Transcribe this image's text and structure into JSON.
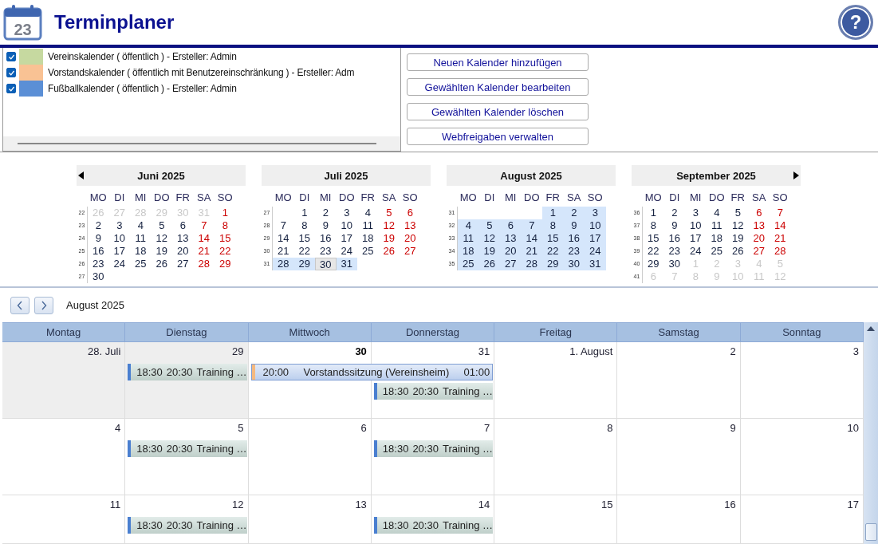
{
  "header": {
    "icon_day": "23",
    "title": "Terminplaner",
    "help_label": "?"
  },
  "calendars": [
    {
      "name": "Vereinskalender ( öffentlich ) - Ersteller: Admin",
      "checked": true,
      "color": "#c6d9a0"
    },
    {
      "name": "Vorstandskalender ( öffentlich mit Benutzereinschränkung ) - Ersteller: Adm",
      "checked": true,
      "color": "#f9c294"
    },
    {
      "name": "Fußballkalender ( öffentlich ) - Ersteller: Admin",
      "checked": true,
      "color": "#5b8fd6"
    }
  ],
  "calendar_buttons": [
    "Neuen Kalender hinzufügen",
    "Gewählten Kalender bearbeiten",
    "Gewählten Kalender löschen",
    "Webfreigaben verwalten"
  ],
  "mini_months": [
    {
      "title": "Juni 2025",
      "has_prev": true,
      "has_next": false,
      "weekdays": [
        "MO",
        "DI",
        "MI",
        "DO",
        "FR",
        "SA",
        "SO"
      ],
      "weeks": [
        {
          "number": "22",
          "days": [
            {
              "d": "26",
              "kind": "muted",
              "selected": false,
              "today": false
            },
            {
              "d": "27",
              "kind": "muted",
              "selected": false,
              "today": false
            },
            {
              "d": "28",
              "kind": "muted",
              "selected": false,
              "today": false
            },
            {
              "d": "29",
              "kind": "muted",
              "selected": false,
              "today": false
            },
            {
              "d": "30",
              "kind": "muted",
              "selected": false,
              "today": false
            },
            {
              "d": "31",
              "kind": "muted",
              "selected": false,
              "today": false
            },
            {
              "d": "1",
              "kind": "weekend",
              "selected": false,
              "today": false
            }
          ]
        },
        {
          "number": "23",
          "days": [
            {
              "d": "2",
              "kind": "normal",
              "selected": false,
              "today": false
            },
            {
              "d": "3",
              "kind": "normal",
              "selected": false,
              "today": false
            },
            {
              "d": "4",
              "kind": "normal",
              "selected": false,
              "today": false
            },
            {
              "d": "5",
              "kind": "normal",
              "selected": false,
              "today": false
            },
            {
              "d": "6",
              "kind": "normal",
              "selected": false,
              "today": false
            },
            {
              "d": "7",
              "kind": "weekend",
              "selected": false,
              "today": false
            },
            {
              "d": "8",
              "kind": "weekend",
              "selected": false,
              "today": false
            }
          ]
        },
        {
          "number": "24",
          "days": [
            {
              "d": "9",
              "kind": "normal",
              "selected": false,
              "today": false
            },
            {
              "d": "10",
              "kind": "normal",
              "selected": false,
              "today": false
            },
            {
              "d": "11",
              "kind": "normal",
              "selected": false,
              "today": false
            },
            {
              "d": "12",
              "kind": "normal",
              "selected": false,
              "today": false
            },
            {
              "d": "13",
              "kind": "normal",
              "selected": false,
              "today": false
            },
            {
              "d": "14",
              "kind": "weekend",
              "selected": false,
              "today": false
            },
            {
              "d": "15",
              "kind": "weekend",
              "selected": false,
              "today": false
            }
          ]
        },
        {
          "number": "25",
          "days": [
            {
              "d": "16",
              "kind": "normal",
              "selected": false,
              "today": false
            },
            {
              "d": "17",
              "kind": "normal",
              "selected": false,
              "today": false
            },
            {
              "d": "18",
              "kind": "normal",
              "selected": false,
              "today": false
            },
            {
              "d": "19",
              "kind": "normal",
              "selected": false,
              "today": false
            },
            {
              "d": "20",
              "kind": "normal",
              "selected": false,
              "today": false
            },
            {
              "d": "21",
              "kind": "weekend",
              "selected": false,
              "today": false
            },
            {
              "d": "22",
              "kind": "weekend",
              "selected": false,
              "today": false
            }
          ]
        },
        {
          "number": "26",
          "days": [
            {
              "d": "23",
              "kind": "normal",
              "selected": false,
              "today": false
            },
            {
              "d": "24",
              "kind": "normal",
              "selected": false,
              "today": false
            },
            {
              "d": "25",
              "kind": "normal",
              "selected": false,
              "today": false
            },
            {
              "d": "26",
              "kind": "normal",
              "selected": false,
              "today": false
            },
            {
              "d": "27",
              "kind": "normal",
              "selected": false,
              "today": false
            },
            {
              "d": "28",
              "kind": "weekend",
              "selected": false,
              "today": false
            },
            {
              "d": "29",
              "kind": "weekend",
              "selected": false,
              "today": false
            }
          ]
        },
        {
          "number": "27",
          "days": [
            {
              "d": "30",
              "kind": "normal",
              "selected": false,
              "today": false
            },
            {
              "kind": "blank"
            },
            {
              "kind": "blank"
            },
            {
              "kind": "blank"
            },
            {
              "kind": "blank"
            },
            {
              "kind": "blank"
            },
            {
              "kind": "blank"
            }
          ]
        }
      ]
    },
    {
      "title": "Juli 2025",
      "has_prev": false,
      "has_next": false,
      "weekdays": [
        "MO",
        "DI",
        "MI",
        "DO",
        "FR",
        "SA",
        "SO"
      ],
      "weeks": [
        {
          "number": "27",
          "days": [
            {
              "kind": "blank"
            },
            {
              "d": "1",
              "kind": "normal",
              "selected": false,
              "today": false
            },
            {
              "d": "2",
              "kind": "normal",
              "selected": false,
              "today": false
            },
            {
              "d": "3",
              "kind": "normal",
              "selected": false,
              "today": false
            },
            {
              "d": "4",
              "kind": "normal",
              "selected": false,
              "today": false
            },
            {
              "d": "5",
              "kind": "weekend",
              "selected": false,
              "today": false
            },
            {
              "d": "6",
              "kind": "weekend",
              "selected": false,
              "today": false
            }
          ]
        },
        {
          "number": "28",
          "days": [
            {
              "d": "7",
              "kind": "normal",
              "selected": false,
              "today": false
            },
            {
              "d": "8",
              "kind": "normal",
              "selected": false,
              "today": false
            },
            {
              "d": "9",
              "kind": "normal",
              "selected": false,
              "today": false
            },
            {
              "d": "10",
              "kind": "normal",
              "selected": false,
              "today": false
            },
            {
              "d": "11",
              "kind": "normal",
              "selected": false,
              "today": false
            },
            {
              "d": "12",
              "kind": "weekend",
              "selected": false,
              "today": false
            },
            {
              "d": "13",
              "kind": "weekend",
              "selected": false,
              "today": false
            }
          ]
        },
        {
          "number": "29",
          "days": [
            {
              "d": "14",
              "kind": "normal",
              "selected": false,
              "today": false
            },
            {
              "d": "15",
              "kind": "normal",
              "selected": false,
              "today": false
            },
            {
              "d": "16",
              "kind": "normal",
              "selected": false,
              "today": false
            },
            {
              "d": "17",
              "kind": "normal",
              "selected": false,
              "today": false
            },
            {
              "d": "18",
              "kind": "normal",
              "selected": false,
              "today": false
            },
            {
              "d": "19",
              "kind": "weekend",
              "selected": false,
              "today": false
            },
            {
              "d": "20",
              "kind": "weekend",
              "selected": false,
              "today": false
            }
          ]
        },
        {
          "number": "30",
          "days": [
            {
              "d": "21",
              "kind": "normal",
              "selected": false,
              "today": false
            },
            {
              "d": "22",
              "kind": "normal",
              "selected": false,
              "today": false
            },
            {
              "d": "23",
              "kind": "normal",
              "selected": false,
              "today": false
            },
            {
              "d": "24",
              "kind": "normal",
              "selected": false,
              "today": false
            },
            {
              "d": "25",
              "kind": "normal",
              "selected": false,
              "today": false
            },
            {
              "d": "26",
              "kind": "weekend",
              "selected": false,
              "today": false
            },
            {
              "d": "27",
              "kind": "weekend",
              "selected": false,
              "today": false
            }
          ]
        },
        {
          "number": "31",
          "days": [
            {
              "d": "28",
              "kind": "normal",
              "selected": true,
              "today": false
            },
            {
              "d": "29",
              "kind": "normal",
              "selected": true,
              "today": false
            },
            {
              "d": "30",
              "kind": "normal",
              "selected": true,
              "today": true
            },
            {
              "d": "31",
              "kind": "normal",
              "selected": true,
              "today": false
            },
            {
              "kind": "blank"
            },
            {
              "kind": "blank"
            },
            {
              "kind": "blank"
            }
          ]
        }
      ]
    },
    {
      "title": "August 2025",
      "has_prev": false,
      "has_next": false,
      "weekdays": [
        "MO",
        "DI",
        "MI",
        "DO",
        "FR",
        "SA",
        "SO"
      ],
      "weeks": [
        {
          "number": "31",
          "days": [
            {
              "kind": "blank"
            },
            {
              "kind": "blank"
            },
            {
              "kind": "blank"
            },
            {
              "kind": "blank"
            },
            {
              "d": "1",
              "kind": "normal",
              "selected": true,
              "today": false
            },
            {
              "d": "2",
              "kind": "normal",
              "selected": true,
              "today": false
            },
            {
              "d": "3",
              "kind": "normal",
              "selected": true,
              "today": false
            }
          ]
        },
        {
          "number": "32",
          "days": [
            {
              "d": "4",
              "kind": "normal",
              "selected": true,
              "today": false
            },
            {
              "d": "5",
              "kind": "normal",
              "selected": true,
              "today": false
            },
            {
              "d": "6",
              "kind": "normal",
              "selected": true,
              "today": false
            },
            {
              "d": "7",
              "kind": "normal",
              "selected": true,
              "today": false
            },
            {
              "d": "8",
              "kind": "normal",
              "selected": true,
              "today": false
            },
            {
              "d": "9",
              "kind": "normal",
              "selected": true,
              "today": false
            },
            {
              "d": "10",
              "kind": "normal",
              "selected": true,
              "today": false
            }
          ]
        },
        {
          "number": "33",
          "days": [
            {
              "d": "11",
              "kind": "normal",
              "selected": true,
              "today": false
            },
            {
              "d": "12",
              "kind": "normal",
              "selected": true,
              "today": false
            },
            {
              "d": "13",
              "kind": "normal",
              "selected": true,
              "today": false
            },
            {
              "d": "14",
              "kind": "normal",
              "selected": true,
              "today": false
            },
            {
              "d": "15",
              "kind": "normal",
              "selected": true,
              "today": false
            },
            {
              "d": "16",
              "kind": "normal",
              "selected": true,
              "today": false
            },
            {
              "d": "17",
              "kind": "normal",
              "selected": true,
              "today": false
            }
          ]
        },
        {
          "number": "34",
          "days": [
            {
              "d": "18",
              "kind": "normal",
              "selected": true,
              "today": false
            },
            {
              "d": "19",
              "kind": "normal",
              "selected": true,
              "today": false
            },
            {
              "d": "20",
              "kind": "normal",
              "selected": true,
              "today": false
            },
            {
              "d": "21",
              "kind": "normal",
              "selected": true,
              "today": false
            },
            {
              "d": "22",
              "kind": "normal",
              "selected": true,
              "today": false
            },
            {
              "d": "23",
              "kind": "normal",
              "selected": true,
              "today": false
            },
            {
              "d": "24",
              "kind": "normal",
              "selected": true,
              "today": false
            }
          ]
        },
        {
          "number": "35",
          "days": [
            {
              "d": "25",
              "kind": "normal",
              "selected": true,
              "today": false
            },
            {
              "d": "26",
              "kind": "normal",
              "selected": true,
              "today": false
            },
            {
              "d": "27",
              "kind": "normal",
              "selected": true,
              "today": false
            },
            {
              "d": "28",
              "kind": "normal",
              "selected": true,
              "today": false
            },
            {
              "d": "29",
              "kind": "normal",
              "selected": true,
              "today": false
            },
            {
              "d": "30",
              "kind": "normal",
              "selected": true,
              "today": false
            },
            {
              "d": "31",
              "kind": "normal",
              "selected": true,
              "today": false
            }
          ]
        }
      ]
    },
    {
      "title": "September 2025",
      "has_prev": false,
      "has_next": true,
      "weekdays": [
        "MO",
        "DI",
        "MI",
        "DO",
        "FR",
        "SA",
        "SO"
      ],
      "weeks": [
        {
          "number": "36",
          "days": [
            {
              "d": "1",
              "kind": "normal",
              "selected": false,
              "today": false
            },
            {
              "d": "2",
              "kind": "normal",
              "selected": false,
              "today": false
            },
            {
              "d": "3",
              "kind": "normal",
              "selected": false,
              "today": false
            },
            {
              "d": "4",
              "kind": "normal",
              "selected": false,
              "today": false
            },
            {
              "d": "5",
              "kind": "normal",
              "selected": false,
              "today": false
            },
            {
              "d": "6",
              "kind": "weekend",
              "selected": false,
              "today": false
            },
            {
              "d": "7",
              "kind": "weekend",
              "selected": false,
              "today": false
            }
          ]
        },
        {
          "number": "37",
          "days": [
            {
              "d": "8",
              "kind": "normal",
              "selected": false,
              "today": false
            },
            {
              "d": "9",
              "kind": "normal",
              "selected": false,
              "today": false
            },
            {
              "d": "10",
              "kind": "normal",
              "selected": false,
              "today": false
            },
            {
              "d": "11",
              "kind": "normal",
              "selected": false,
              "today": false
            },
            {
              "d": "12",
              "kind": "normal",
              "selected": false,
              "today": false
            },
            {
              "d": "13",
              "kind": "weekend",
              "selected": false,
              "today": false
            },
            {
              "d": "14",
              "kind": "weekend",
              "selected": false,
              "today": false
            }
          ]
        },
        {
          "number": "38",
          "days": [
            {
              "d": "15",
              "kind": "normal",
              "selected": false,
              "today": false
            },
            {
              "d": "16",
              "kind": "normal",
              "selected": false,
              "today": false
            },
            {
              "d": "17",
              "kind": "normal",
              "selected": false,
              "today": false
            },
            {
              "d": "18",
              "kind": "normal",
              "selected": false,
              "today": false
            },
            {
              "d": "19",
              "kind": "normal",
              "selected": false,
              "today": false
            },
            {
              "d": "20",
              "kind": "weekend",
              "selected": false,
              "today": false
            },
            {
              "d": "21",
              "kind": "weekend",
              "selected": false,
              "today": false
            }
          ]
        },
        {
          "number": "39",
          "days": [
            {
              "d": "22",
              "kind": "normal",
              "selected": false,
              "today": false
            },
            {
              "d": "23",
              "kind": "normal",
              "selected": false,
              "today": false
            },
            {
              "d": "24",
              "kind": "normal",
              "selected": false,
              "today": false
            },
            {
              "d": "25",
              "kind": "normal",
              "selected": false,
              "today": false
            },
            {
              "d": "26",
              "kind": "normal",
              "selected": false,
              "today": false
            },
            {
              "d": "27",
              "kind": "weekend",
              "selected": false,
              "today": false
            },
            {
              "d": "28",
              "kind": "weekend",
              "selected": false,
              "today": false
            }
          ]
        },
        {
          "number": "40",
          "days": [
            {
              "d": "29",
              "kind": "normal",
              "selected": false,
              "today": false
            },
            {
              "d": "30",
              "kind": "normal",
              "selected": false,
              "today": false
            },
            {
              "d": "1",
              "kind": "muted",
              "selected": false,
              "today": false
            },
            {
              "d": "2",
              "kind": "muted",
              "selected": false,
              "today": false
            },
            {
              "d": "3",
              "kind": "muted",
              "selected": false,
              "today": false
            },
            {
              "d": "4",
              "kind": "muted",
              "selected": false,
              "today": false
            },
            {
              "d": "5",
              "kind": "muted",
              "selected": false,
              "today": false
            }
          ]
        },
        {
          "number": "41",
          "days": [
            {
              "d": "6",
              "kind": "muted",
              "selected": false,
              "today": false
            },
            {
              "d": "7",
              "kind": "muted",
              "selected": false,
              "today": false
            },
            {
              "d": "8",
              "kind": "muted",
              "selected": false,
              "today": false
            },
            {
              "d": "9",
              "kind": "muted",
              "selected": false,
              "today": false
            },
            {
              "d": "10",
              "kind": "muted",
              "selected": false,
              "today": false
            },
            {
              "d": "11",
              "kind": "muted",
              "selected": false,
              "today": false
            },
            {
              "d": "12",
              "kind": "muted",
              "selected": false,
              "today": false
            }
          ]
        }
      ]
    }
  ],
  "month_view": {
    "title": "August 2025",
    "columns": [
      "Montag",
      "Dienstag",
      "Mittwoch",
      "Donnerstag",
      "Freitag",
      "Samstag",
      "Sonntag"
    ],
    "weeks": [
      {
        "cells": [
          {
            "label": "28. Juli",
            "shaded": true,
            "today": false
          },
          {
            "label": "29",
            "shaded": true,
            "today": false
          },
          {
            "label": "30",
            "shaded": false,
            "today": true
          },
          {
            "label": "31",
            "shaded": false,
            "today": false
          },
          {
            "label": "1. August",
            "shaded": false,
            "today": false
          },
          {
            "label": "2",
            "shaded": false,
            "today": false
          },
          {
            "label": "3",
            "shaded": false,
            "today": false
          }
        ],
        "lanes": [
          [
            {
              "kind": "empty"
            },
            {
              "kind": "single",
              "start": "18:30",
              "end": "20:30",
              "title": "Training …",
              "color": "#4a7fd0",
              "selected": false
            },
            {
              "kind": "multi",
              "start": "20:00",
              "end": "01:00",
              "title": "Vorstandssitzung (Vereinsheim)",
              "color": "#f5b97f",
              "selected": true
            },
            {
              "kind": "continuation"
            },
            {
              "kind": "empty"
            },
            {
              "kind": "empty"
            },
            {
              "kind": "empty"
            }
          ],
          [
            {
              "kind": "empty"
            },
            {
              "kind": "empty"
            },
            {
              "kind": "empty"
            },
            {
              "kind": "single",
              "start": "18:30",
              "end": "20:30",
              "title": "Training …",
              "color": "#4a7fd0",
              "selected": false
            },
            {
              "kind": "empty"
            },
            {
              "kind": "empty"
            },
            {
              "kind": "empty"
            }
          ]
        ]
      },
      {
        "cells": [
          {
            "label": "4",
            "shaded": false,
            "today": false
          },
          {
            "label": "5",
            "shaded": false,
            "today": false
          },
          {
            "label": "6",
            "shaded": false,
            "today": false
          },
          {
            "label": "7",
            "shaded": false,
            "today": false
          },
          {
            "label": "8",
            "shaded": false,
            "today": false
          },
          {
            "label": "9",
            "shaded": false,
            "today": false
          },
          {
            "label": "10",
            "shaded": false,
            "today": false
          }
        ],
        "lanes": [
          [
            {
              "kind": "empty"
            },
            {
              "kind": "single",
              "start": "18:30",
              "end": "20:30",
              "title": "Training …",
              "color": "#4a7fd0",
              "selected": false
            },
            {
              "kind": "empty"
            },
            {
              "kind": "single",
              "start": "18:30",
              "end": "20:30",
              "title": "Training …",
              "color": "#4a7fd0",
              "selected": false
            },
            {
              "kind": "empty"
            },
            {
              "kind": "empty"
            },
            {
              "kind": "empty"
            }
          ]
        ]
      },
      {
        "cells": [
          {
            "label": "11",
            "shaded": false,
            "today": false
          },
          {
            "label": "12",
            "shaded": false,
            "today": false
          },
          {
            "label": "13",
            "shaded": false,
            "today": false
          },
          {
            "label": "14",
            "shaded": false,
            "today": false
          },
          {
            "label": "15",
            "shaded": false,
            "today": false
          },
          {
            "label": "16",
            "shaded": false,
            "today": false
          },
          {
            "label": "17",
            "shaded": false,
            "today": false
          }
        ],
        "lanes": [
          [
            {
              "kind": "empty"
            },
            {
              "kind": "single",
              "start": "18:30",
              "end": "20:30",
              "title": "Training …",
              "color": "#4a7fd0",
              "selected": false
            },
            {
              "kind": "empty"
            },
            {
              "kind": "single",
              "start": "18:30",
              "end": "20:30",
              "title": "Training …",
              "color": "#4a7fd0",
              "selected": false
            },
            {
              "kind": "empty"
            },
            {
              "kind": "empty"
            },
            {
              "kind": "empty"
            }
          ]
        ]
      }
    ]
  }
}
